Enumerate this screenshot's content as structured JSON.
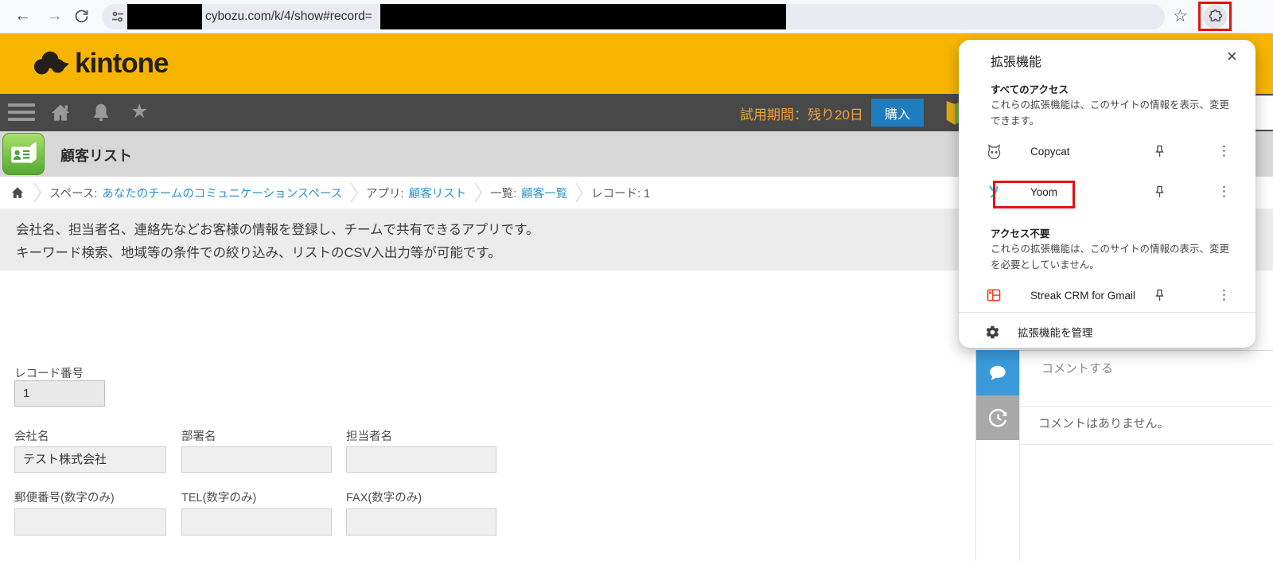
{
  "glyphs": {
    "back": "←",
    "forward": "→",
    "star_outline": "☆",
    "star_filled": "★",
    "close": "×",
    "kebab": "⋮"
  },
  "browser_toolbar": {
    "url_text": "cybozu.com/k/4/show#record="
  },
  "kintone_header": {
    "logo_text": "kintone"
  },
  "navbar": {
    "trial_text": "試用期間：残り20日",
    "purchase_label": "購入"
  },
  "app_header": {
    "title": "顧客リスト"
  },
  "breadcrumb": {
    "space_label": "スペース:",
    "space_link": "あなたのチームのコミュニケーションスペース",
    "app_label": "アプリ:",
    "app_link": "顧客リスト",
    "list_label": "一覧:",
    "list_link": "顧客一覧",
    "record_label": "レコード: 1"
  },
  "description": {
    "line1": "会社名、担当者名、連絡先などお客様の情報を登録し、チームで共有できるアプリです。",
    "line2": "キーワード検索、地域等の条件での絞り込み、リストのCSV入出力等が可能です。"
  },
  "form": {
    "record_number": {
      "label": "レコード番号",
      "value": "1"
    },
    "company": {
      "label": "会社名",
      "value": "テスト株式会社"
    },
    "department": {
      "label": "部署名",
      "value": ""
    },
    "person": {
      "label": "担当者名",
      "value": ""
    },
    "zip": {
      "label": "郵便番号(数字のみ)",
      "value": ""
    },
    "tel": {
      "label": "TEL(数字のみ)",
      "value": ""
    },
    "fax": {
      "label": "FAX(数字のみ)",
      "value": ""
    }
  },
  "comments": {
    "placeholder": "コメントする",
    "empty_message": "コメントはありません。"
  },
  "extensions_popup": {
    "title": "拡張機能",
    "full_access": {
      "heading": "すべてのアクセス",
      "description": "これらの拡張機能は、このサイトの情報を表示、変更できます。",
      "items": [
        {
          "name": "Copycat"
        },
        {
          "name": "Yoom"
        }
      ]
    },
    "no_access": {
      "heading": "アクセス不要",
      "description": "これらの拡張機能は、このサイトの情報の表示、変更を必要としていません。",
      "items": [
        {
          "name": "Streak CRM for Gmail"
        }
      ]
    },
    "manage_label": "拡張機能を管理"
  },
  "colors": {
    "kintone_yellow": "#f8b500",
    "navbar_gray": "#484848",
    "purchase_blue": "#1e7dbe",
    "trial_orange": "#efa23c",
    "link_blue": "#3090d0",
    "comment_blue": "#3b9adb",
    "history_gray": "#a9a9a9",
    "highlight_red": "#e31212",
    "yoom_cyan": "#2bc4d4",
    "streak_orange": "#e8472a"
  }
}
